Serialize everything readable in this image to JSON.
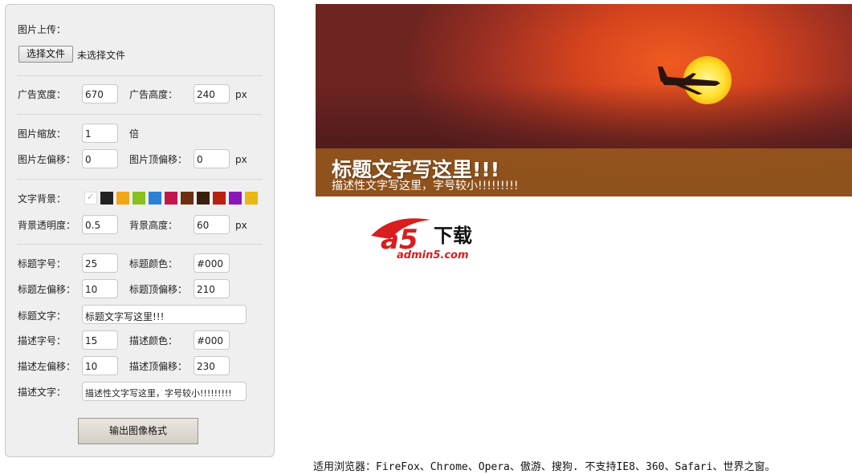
{
  "form": {
    "upload_label": "图片上传：",
    "file_button": "选择文件",
    "file_status": "未选择文件",
    "ad_width_label": "广告宽度：",
    "ad_width": "670",
    "ad_height_label": "广告高度：",
    "ad_height": "240",
    "px": "px",
    "zoom_label": "图片缩放：",
    "zoom": "1",
    "zoom_unit": "倍",
    "img_left_label": "图片左偏移：",
    "img_left": "0",
    "img_top_label": "图片顶偏移：",
    "img_top": "0",
    "text_bg_label": "文字背景：",
    "bg_opacity_label": "背景透明度：",
    "bg_opacity": "0.5",
    "bg_height_label": "背景高度：",
    "bg_height": "60",
    "title_size_label": "标题字号：",
    "title_size": "25",
    "title_color_label": "标题颜色：",
    "title_color": "#000",
    "title_left_label": "标题左偏移：",
    "title_left": "10",
    "title_top_label": "标题顶偏移：",
    "title_top": "210",
    "title_text_label": "标题文字：",
    "title_text": "标题文字写这里!!!",
    "desc_size_label": "描述字号：",
    "desc_size": "15",
    "desc_color_label": "描述颜色：",
    "desc_color": "#000",
    "desc_left_label": "描述左偏移：",
    "desc_left": "10",
    "desc_top_label": "描述顶偏移：",
    "desc_top": "230",
    "desc_text_label": "描述文字：",
    "desc_text": "描述性文字写这里，字号较小!!!!!!!!!",
    "output_button": "输出图像格式",
    "swatches": [
      "#ffffff",
      "#222222",
      "#f0a818",
      "#88c020",
      "#2c7fd8",
      "#c0184c",
      "#6a3010",
      "#3a200c",
      "#b82010",
      "#8a18b8",
      "#e8b818"
    ]
  },
  "preview": {
    "title": "标题文字写这里!!!",
    "desc": "描述性文字写这里，字号较小!!!!!!!!!"
  },
  "logo": {
    "mark": "a5",
    "cn": "下载",
    "site": "admin5.com"
  },
  "footer": "适用浏览器：FireFox、Chrome、Opera、傲游、搜狗. 不支持IE8、360、Safari、世界之窗。"
}
